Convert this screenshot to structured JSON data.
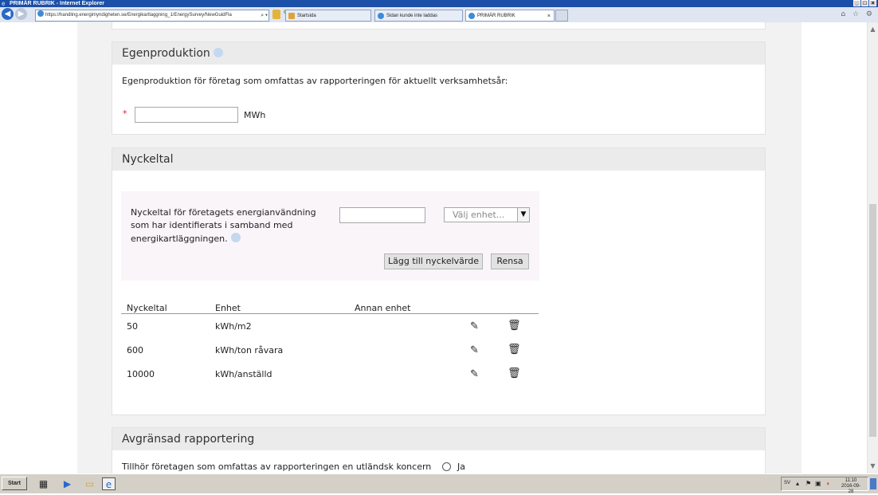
{
  "window": {
    "title": "PRIMÄR RUBRIK - Internet Explorer",
    "controls": [
      "_",
      "□",
      "×"
    ]
  },
  "browser": {
    "address": "https://handling.energimyndigheten.se/Energikartlaggning_1/EnergySurvey/NewGuidFla",
    "address_controls": "⌕ ▾",
    "tabs": [
      {
        "label": "Startsida",
        "icon": "home-icon"
      },
      {
        "label": "Sidan kunde inte laddas",
        "icon": "ie-page-icon"
      },
      {
        "label": "PRIMÄR RUBRIK",
        "icon": "ie-page-icon",
        "active": true,
        "close": "×"
      }
    ],
    "right_tools": "⌂ ☆ ⚙"
  },
  "egenproduktion": {
    "heading": "Egenproduktion",
    "description": "Egenproduktion för företag som omfattas av rapporteringen för aktuellt verksamhetsår:",
    "required_mark": "*",
    "value": "",
    "unit": "MWh"
  },
  "nyckeltal": {
    "heading": "Nyckeltal",
    "form_label_lines": [
      "Nyckeltal för företagets energianvändning",
      "som har identifierats i samband med",
      "energikartläggningen."
    ],
    "value": "",
    "unit_placeholder": "Välj enhet...",
    "add_button": "Lägg till nyckelvärde",
    "clear_button": "Rensa",
    "table": {
      "headers": [
        "Nyckeltal",
        "Enhet",
        "Annan enhet"
      ],
      "rows": [
        {
          "value": "50",
          "unit": "kWh/m2",
          "other": ""
        },
        {
          "value": "600",
          "unit": "kWh/ton råvara",
          "other": ""
        },
        {
          "value": "10000",
          "unit": "kWh/anställd",
          "other": ""
        }
      ]
    }
  },
  "avgransad": {
    "heading": "Avgränsad rapportering",
    "question": "Tillhör företagen som omfattas av rapporteringen en utländsk koncern",
    "option_yes": "Ja"
  },
  "taskbar": {
    "start": "Start",
    "lang": "SV",
    "time": "11:10",
    "date": "2016-09-28"
  }
}
